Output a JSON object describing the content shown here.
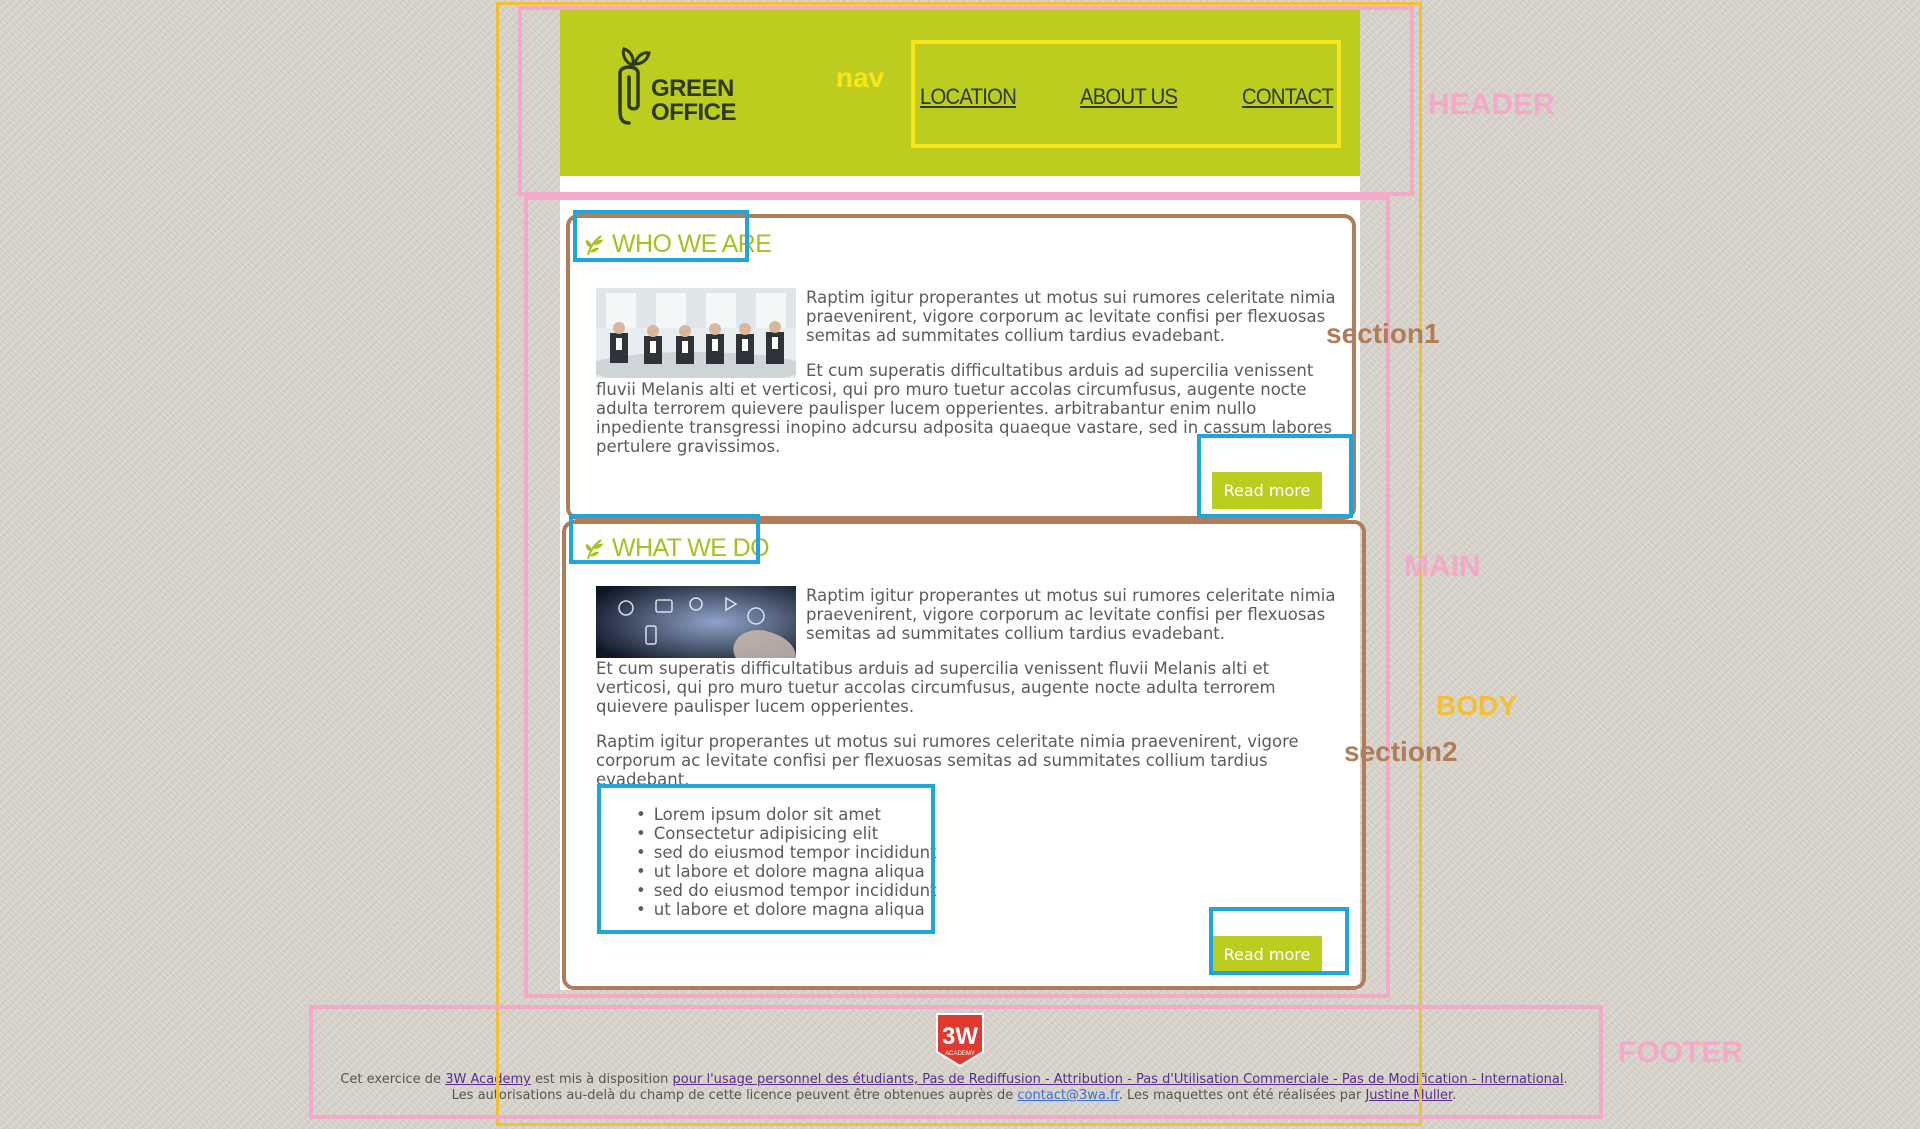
{
  "header": {
    "logo_line1": "GREEN",
    "logo_line2": "OFFICE",
    "nav": [
      "LOCATION",
      "ABOUT US",
      "CONTACT"
    ]
  },
  "sections": [
    {
      "title": "WHO WE ARE",
      "paragraphs": [
        "Raptim igitur properantes ut motus sui rumores celeritate nimia praevenirent, vigore corporum ac levitate confisi per flexuosas semitas ad summitates collium tardius evadebant.",
        "Et cum superatis difficultatibus arduis ad supercilia venissent fluvii Melanis alti et verticosi, qui pro muro tuetur accolas circumfusus, augente nocte adulta terrorem quievere paulisper lucem opperientes. arbitrabantur enim nullo inpediente transgressi inopino adcursu adposita quaeque vastare, sed in cassum labores pertulere gravissimos."
      ],
      "button": "Read more"
    },
    {
      "title": "WHAT WE DO",
      "paragraphs": [
        "Raptim igitur properantes ut motus sui rumores celeritate nimia praevenirent, vigore corporum ac levitate confisi per flexuosas semitas ad summitates collium tardius evadebant.",
        "Et cum superatis difficultatibus arduis ad supercilia venissent fluvii Melanis alti et verticosi, qui pro muro tuetur accolas circumfusus, augente nocte adulta terrorem quievere paulisper lucem opperientes.",
        "Raptim igitur properantes ut motus sui rumores celeritate nimia praevenirent, vigore corporum ac levitate confisi per flexuosas semitas ad summitates collium tardius evadebant."
      ],
      "list": [
        "Lorem ipsum dolor sit amet",
        "Consectetur adipisicing elit",
        "sed do eiusmod tempor incididunt",
        "ut labore et dolore magna aliqua",
        "sed do eiusmod tempor incididunt",
        "ut labore et dolore magna aliqua"
      ],
      "button": "Read more"
    }
  ],
  "footer": {
    "badge_main": "3W",
    "badge_sub": "ACADEMY",
    "line1_a": "Cet exercice de ",
    "line1_link1": "3W Academy",
    "line1_b": " est mis à disposition ",
    "line1_link2": "pour l'usage personnel des étudiants, Pas de Rediffusion - Attribution - Pas d'Utilisation Commerciale - Pas de Modification - International",
    "line1_c": ".",
    "line2_a": "Les autorisations au-delà du champ de cette licence peuvent être obtenues auprès de ",
    "line2_email": "contact@3wa.fr",
    "line2_b": ". Les maquettes ont été réalisées par ",
    "line2_author": "Justine Muller",
    "line2_c": "."
  },
  "annotations": {
    "nav": "nav",
    "header": "HEADER",
    "section1": "section1",
    "main": "MAIN",
    "body": "BODY",
    "section2": "section2",
    "footer": "FOOTER"
  },
  "colors": {
    "accent_green": "#bccd20",
    "annotation_yellow": "#f6e61b",
    "annotation_pink": "#f5a9c8",
    "annotation_brown": "#b07d5a",
    "annotation_blue": "#1ea6dc",
    "annotation_orange": "#f2c030"
  }
}
